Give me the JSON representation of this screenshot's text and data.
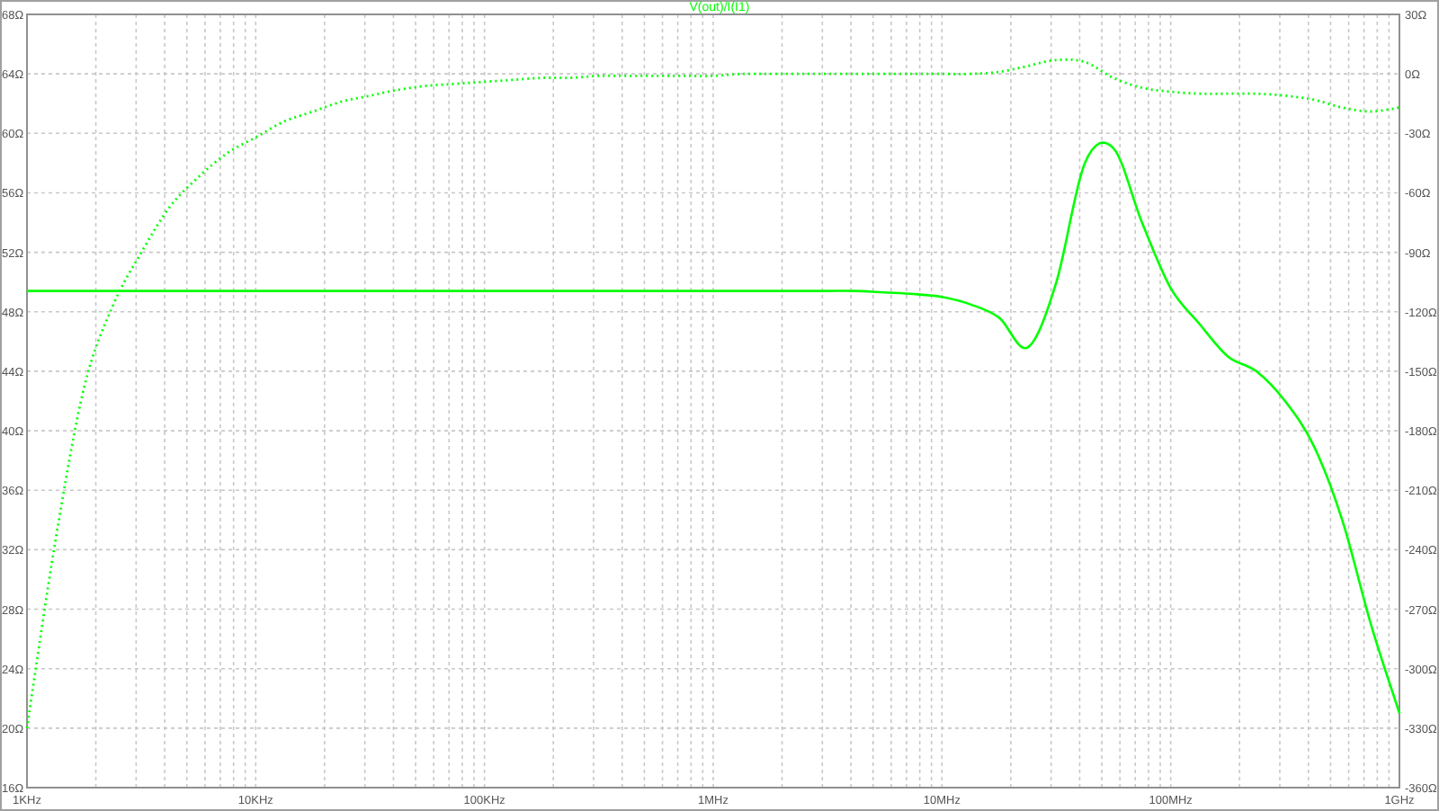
{
  "plot": {
    "chart_data": {
      "type": "line",
      "title": "V(out)/I(I1)",
      "categories": [
        "1KHz",
        null,
        null,
        null,
        null,
        null,
        null,
        null,
        "10KHz",
        null,
        null,
        null,
        null,
        null,
        null,
        null,
        "100KHz",
        null,
        null,
        null,
        null,
        null,
        null,
        null,
        "1MHz",
        null,
        null,
        null,
        null,
        null,
        null,
        null,
        "10MHz",
        null,
        null,
        null,
        null,
        null,
        null,
        null,
        "100MHz",
        null,
        null,
        null,
        null,
        null,
        null,
        null,
        "1GHz"
      ],
      "series": [
        {
          "color": "#00ff00",
          "values": [
            49.4,
            49.4,
            49.4,
            49.4,
            49.4,
            49.4,
            49.4,
            49.4,
            49.4,
            49.4,
            49.4,
            49.4,
            49.4,
            49.4,
            49.4,
            49.4,
            49.4,
            49.4,
            49.4,
            49.4,
            49.4,
            49.4,
            49.4,
            49.4,
            49.4,
            49.4,
            49.4,
            49.4,
            49.4,
            49.4,
            49.3,
            49.2,
            49,
            48.5,
            47.6,
            45.6,
            50,
            58,
            59,
            54,
            49.6,
            47.2,
            45,
            44,
            42,
            39,
            34,
            27,
            21
          ]
        },
        {
          "color": "#00ff00",
          "axis": "y2",
          "line_style": "dotted",
          "values": [
            -330,
            -235,
            -158,
            -117,
            -90,
            -67,
            -52,
            -40,
            -32,
            -24,
            -19,
            -14,
            -11,
            -8,
            -6,
            -5,
            -4,
            -3,
            -2,
            -2,
            -1,
            -1,
            -1,
            -1,
            -1,
            0,
            0,
            0,
            0,
            0,
            0,
            0,
            0,
            0,
            1,
            4,
            7,
            6,
            -2,
            -7,
            -9,
            -10,
            -10,
            -10,
            -11,
            -13,
            -17,
            -19,
            -17
          ]
        }
      ],
      "grid": true,
      "ylim": [
        16,
        68
      ],
      "yticks": [
        {
          "value": 68,
          "label": "68Ω"
        },
        {
          "value": 64,
          "label": "64Ω"
        },
        {
          "value": 60,
          "label": "60Ω"
        },
        {
          "value": 56,
          "label": "56Ω"
        },
        {
          "value": 52,
          "label": "52Ω"
        },
        {
          "value": 48,
          "label": "48Ω"
        },
        {
          "value": 44,
          "label": "44Ω"
        },
        {
          "value": 40,
          "label": "40Ω"
        },
        {
          "value": 36,
          "label": "36Ω"
        },
        {
          "value": 32,
          "label": "32Ω"
        },
        {
          "value": 28,
          "label": "28Ω"
        },
        {
          "value": 24,
          "label": "24Ω"
        },
        {
          "value": 20,
          "label": "20Ω"
        },
        {
          "value": 16,
          "label": "16Ω"
        }
      ],
      "y2lim": [
        -360,
        30
      ],
      "y2ticks": [
        {
          "value": 30,
          "label": "30Ω"
        },
        {
          "value": 0,
          "label": "0Ω"
        },
        {
          "value": -30,
          "label": "-30Ω"
        },
        {
          "value": -60,
          "label": "-60Ω"
        },
        {
          "value": -90,
          "label": "-90Ω"
        },
        {
          "value": -120,
          "label": "-120Ω"
        },
        {
          "value": -150,
          "label": "-150Ω"
        },
        {
          "value": -180,
          "label": "-180Ω"
        },
        {
          "value": -210,
          "label": "-210Ω"
        },
        {
          "value": -240,
          "label": "-240Ω"
        },
        {
          "value": -270,
          "label": "-270Ω"
        },
        {
          "value": -300,
          "label": "-300Ω"
        },
        {
          "value": -330,
          "label": "-330Ω"
        },
        {
          "value": -360,
          "label": "-360Ω"
        }
      ]
    }
  }
}
